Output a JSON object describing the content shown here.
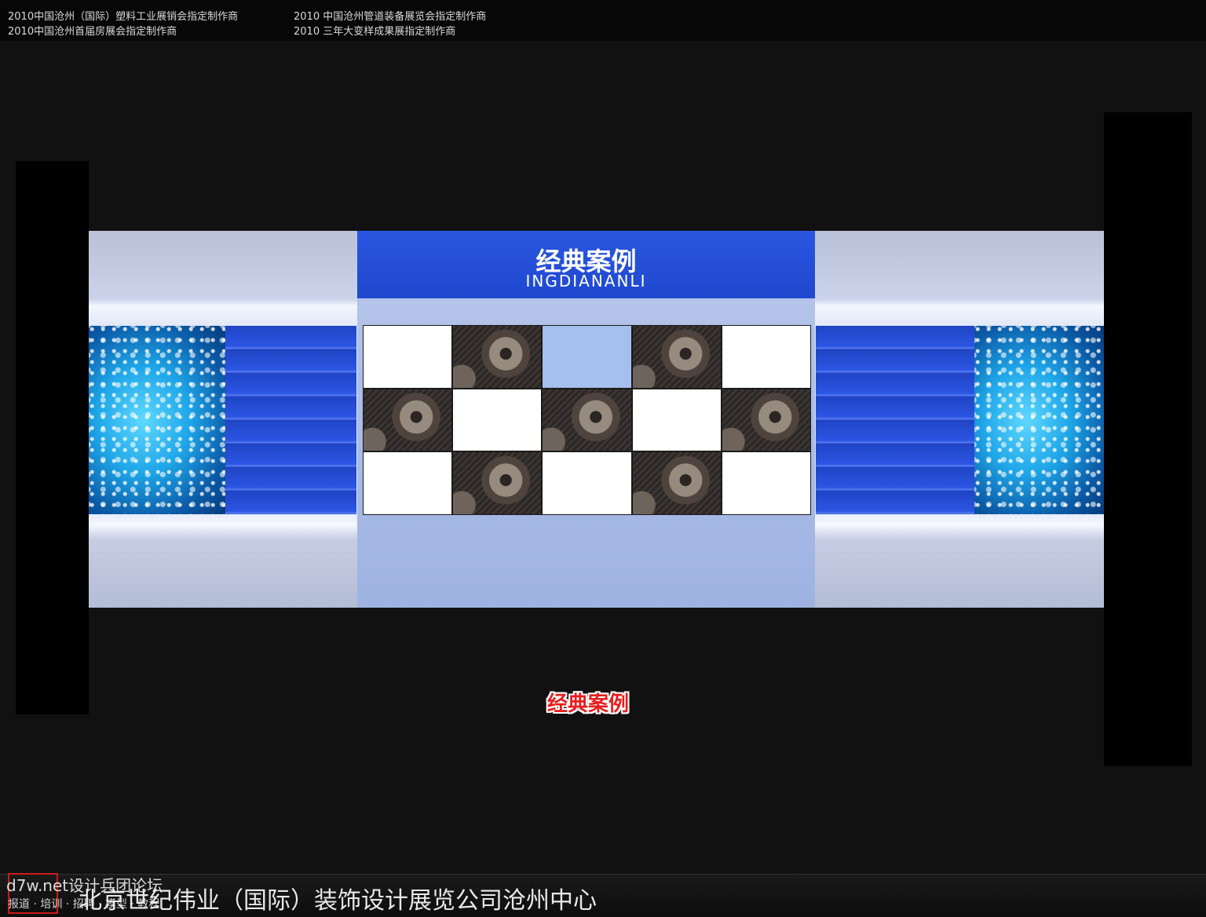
{
  "credits": {
    "line1_left": "2010中国沧州（国际）塑料工业展销会指定制作商",
    "line2_left": "2010中国沧州首届房展会指定制作商",
    "line1_right": "2010 中国沧州管道装备展览会指定制作商",
    "line2_right": "2010 三年大变样成果展指定制作商"
  },
  "booth": {
    "title": "经典案例",
    "subtitle": "INGDIANANLI",
    "grid": [
      [
        "white",
        "gear",
        "sky",
        "gear",
        "white"
      ],
      [
        "gear",
        "white",
        "gear",
        "white",
        "gear"
      ],
      [
        "white",
        "gear",
        "white",
        "gear",
        "white"
      ]
    ]
  },
  "caption": "经典案例",
  "footer": {
    "company": "北京世纪伟业（国际）装饰设计展览公司沧州中心",
    "watermark_top": "d7w.net设计兵团论坛",
    "watermark_bottom": "报道 · 培训 · 招聘 · 模型 · 教程"
  },
  "colors": {
    "background": "#111111",
    "header_blue": "#2a56e0",
    "caption_red": "#e81d1d"
  }
}
